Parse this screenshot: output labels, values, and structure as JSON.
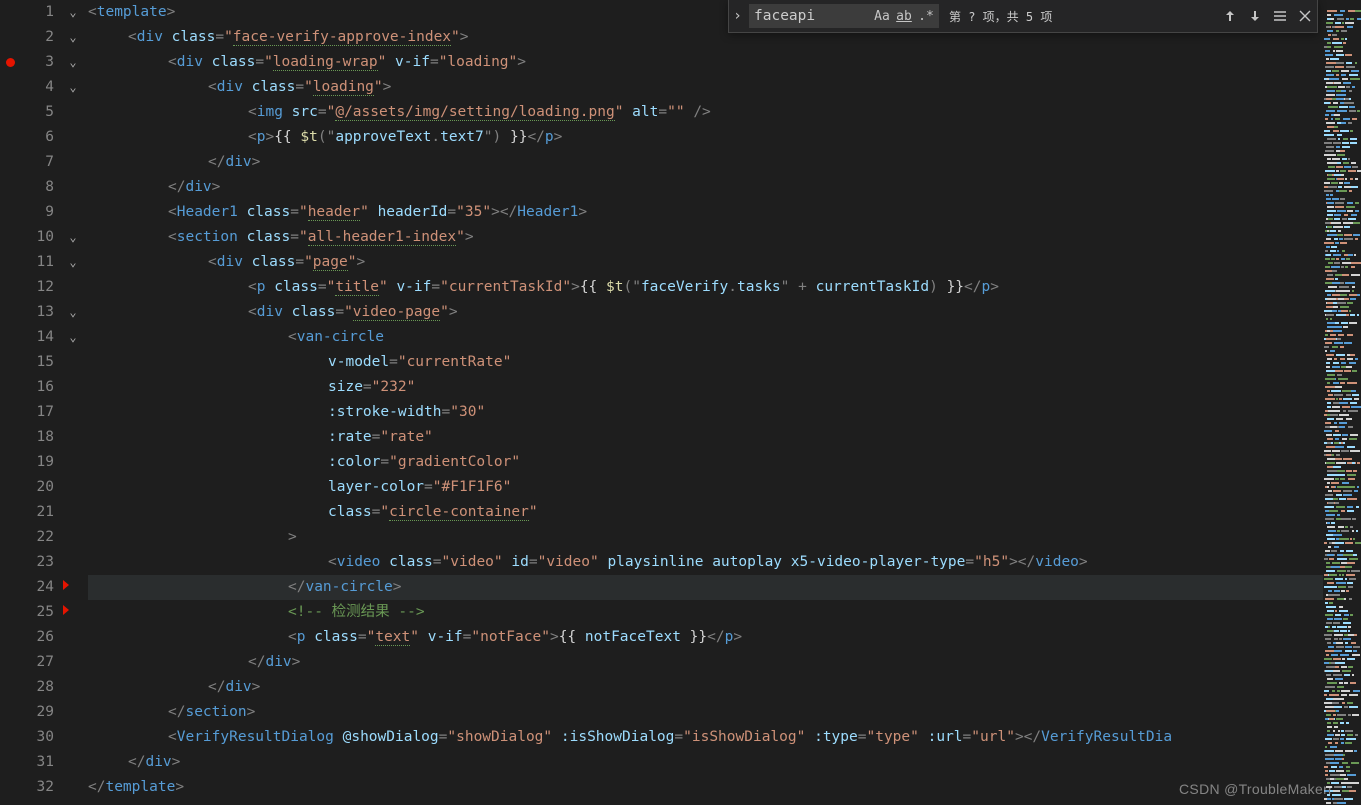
{
  "find": {
    "query": "faceapi",
    "caseSensitive": "Aa",
    "wholeWord": "ab",
    "regex": ".*",
    "count": "第 ? 项，共 5 项"
  },
  "watermark": "CSDN @TroubleMakerr",
  "lines": [
    {
      "n": 1,
      "fold": "v",
      "bp": false,
      "code": "<template>"
    },
    {
      "n": 2,
      "fold": "v",
      "bp": false,
      "code": "    <div class=\"face-verify-approve-index\">"
    },
    {
      "n": 3,
      "fold": "v",
      "bp": true,
      "code": "        <div class=\"loading-wrap\" v-if=\"loading\">"
    },
    {
      "n": 4,
      "fold": "v",
      "bp": false,
      "code": "            <div class=\"loading\">"
    },
    {
      "n": 5,
      "fold": "",
      "bp": false,
      "code": "                <img src=\"@/assets/img/setting/loading.png\" alt=\"\" />"
    },
    {
      "n": 6,
      "fold": "",
      "bp": false,
      "code": "                <p>{{ $t(\"approveText.text7\") }}</p>"
    },
    {
      "n": 7,
      "fold": "",
      "bp": false,
      "code": "            </div>"
    },
    {
      "n": 8,
      "fold": "",
      "bp": false,
      "code": "        </div>"
    },
    {
      "n": 9,
      "fold": "",
      "bp": false,
      "code": "        <Header1 class=\"header\" headerId=\"35\"></Header1>"
    },
    {
      "n": 10,
      "fold": "v",
      "bp": false,
      "code": "        <section class=\"all-header1-index\">"
    },
    {
      "n": 11,
      "fold": "v",
      "bp": false,
      "code": "            <div class=\"page\">"
    },
    {
      "n": 12,
      "fold": "",
      "bp": false,
      "code": "                <p class=\"title\" v-if=\"currentTaskId\">{{ $t(\"faceVerify.tasks\" + currentTaskId) }}</p>"
    },
    {
      "n": 13,
      "fold": "v",
      "bp": false,
      "code": "                <div class=\"video-page\">"
    },
    {
      "n": 14,
      "fold": "v",
      "bp": false,
      "code": "                    <van-circle"
    },
    {
      "n": 15,
      "fold": "",
      "bp": false,
      "code": "                        v-model=\"currentRate\""
    },
    {
      "n": 16,
      "fold": "",
      "bp": false,
      "code": "                        size=\"232\""
    },
    {
      "n": 17,
      "fold": "",
      "bp": false,
      "code": "                        :stroke-width=\"30\""
    },
    {
      "n": 18,
      "fold": "",
      "bp": false,
      "code": "                        :rate=\"rate\""
    },
    {
      "n": 19,
      "fold": "",
      "bp": false,
      "code": "                        :color=\"gradientColor\""
    },
    {
      "n": 20,
      "fold": "",
      "bp": false,
      "code": "                        layer-color=\"#F1F1F6\""
    },
    {
      "n": 21,
      "fold": "",
      "bp": false,
      "code": "                        class=\"circle-container\""
    },
    {
      "n": 22,
      "fold": "",
      "bp": false,
      "code": "                    >"
    },
    {
      "n": 23,
      "fold": "",
      "bp": false,
      "code": "                        <video class=\"video\" id=\"video\" playsinline autoplay x5-video-player-type=\"h5\"></video>"
    },
    {
      "n": 24,
      "fold": "",
      "bp": false,
      "code": "                    </van-circle>"
    },
    {
      "n": 25,
      "fold": "",
      "bp": false,
      "code": "                    <!-- 检测结果 -->"
    },
    {
      "n": 26,
      "fold": "",
      "bp": false,
      "code": "                    <p class=\"text\" v-if=\"notFace\">{{ notFaceText }}</p>"
    },
    {
      "n": 27,
      "fold": "",
      "bp": false,
      "code": "                </div>"
    },
    {
      "n": 28,
      "fold": "",
      "bp": false,
      "code": "            </div>"
    },
    {
      "n": 29,
      "fold": "",
      "bp": false,
      "code": "        </section>"
    },
    {
      "n": 30,
      "fold": "",
      "bp": false,
      "code": "        <VerifyResultDialog @showDialog=\"showDialog\" :isShowDialog=\"isShowDialog\" :type=\"type\" :url=\"url\"></VerifyResultDia"
    },
    {
      "n": 31,
      "fold": "",
      "bp": false,
      "code": "    </div>"
    },
    {
      "n": 32,
      "fold": "",
      "bp": false,
      "code": "</template>"
    }
  ],
  "tokens": {
    "underlined_classes": [
      "face-verify-approve-index",
      "loading-wrap",
      "loading",
      "header",
      "all-header1-index",
      "page",
      "title",
      "video-page",
      "circle-container",
      "text"
    ],
    "underlined_src": [
      "@/assets/img/setting/loading.png"
    ]
  },
  "active_line": 24
}
